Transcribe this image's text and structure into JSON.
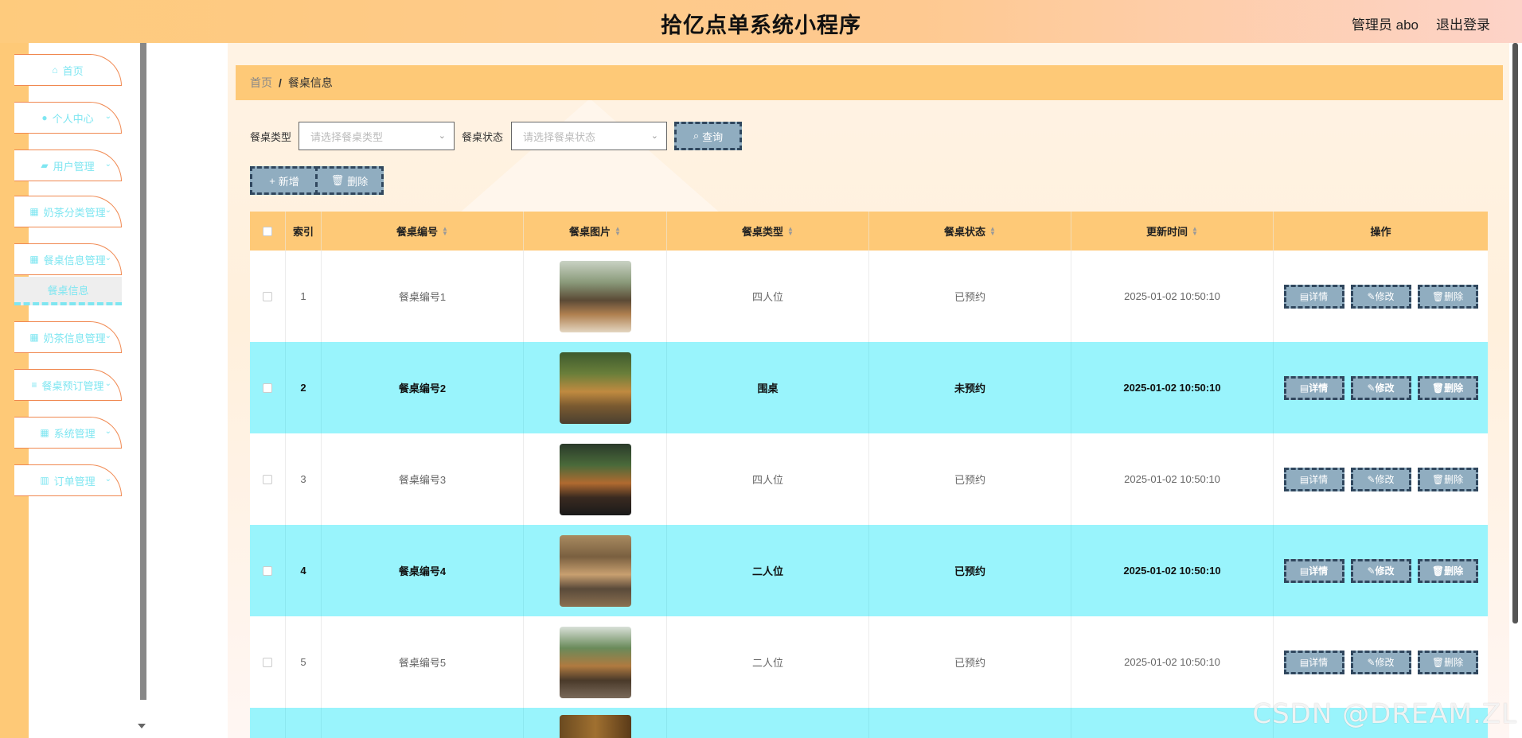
{
  "header": {
    "title": "拾亿点单系统小程序",
    "user": "管理员 abo",
    "logout": "退出登录"
  },
  "sidebar": {
    "items": [
      {
        "label": "首页",
        "icon": "home-icon",
        "has_submenu": false
      },
      {
        "label": "个人中心",
        "icon": "user-icon",
        "has_submenu": true
      },
      {
        "label": "用户管理",
        "icon": "briefcase-icon",
        "has_submenu": true
      },
      {
        "label": "奶茶分类管理",
        "icon": "grid-icon",
        "has_submenu": true
      },
      {
        "label": "餐桌信息管理",
        "icon": "grid-icon",
        "has_submenu": true
      },
      {
        "label": "奶茶信息管理",
        "icon": "grid-icon",
        "has_submenu": true
      },
      {
        "label": "餐桌预订管理",
        "icon": "list-icon",
        "has_submenu": true
      },
      {
        "label": "系统管理",
        "icon": "grid-icon",
        "has_submenu": true
      },
      {
        "label": "订单管理",
        "icon": "trash-icon",
        "has_submenu": true
      }
    ],
    "submenu_active": "餐桌信息"
  },
  "breadcrumb": {
    "home": "首页",
    "separator": "/",
    "current": "餐桌信息"
  },
  "filters": {
    "type_label": "餐桌类型",
    "type_placeholder": "请选择餐桌类型",
    "status_label": "餐桌状态",
    "status_placeholder": "请选择餐桌状态",
    "search_button": "查询"
  },
  "toolbar": {
    "add_button": "新增",
    "delete_button": "删除"
  },
  "table": {
    "headers": [
      "索引",
      "餐桌编号",
      "餐桌图片",
      "餐桌类型",
      "餐桌状态",
      "更新时间",
      "操作"
    ],
    "actions": {
      "detail": "详情",
      "edit": "修改",
      "delete": "删除"
    },
    "rows": [
      {
        "index": "1",
        "number": "餐桌编号1",
        "type": "四人位",
        "status": "已预约",
        "updated": "2025-01-02 10:50:10"
      },
      {
        "index": "2",
        "number": "餐桌编号2",
        "type": "围桌",
        "status": "未预约",
        "updated": "2025-01-02 10:50:10"
      },
      {
        "index": "3",
        "number": "餐桌编号3",
        "type": "四人位",
        "status": "已预约",
        "updated": "2025-01-02 10:50:10"
      },
      {
        "index": "4",
        "number": "餐桌编号4",
        "type": "二人位",
        "status": "已预约",
        "updated": "2025-01-02 10:50:10"
      },
      {
        "index": "5",
        "number": "餐桌编号5",
        "type": "二人位",
        "status": "已预约",
        "updated": "2025-01-02 10:50:10"
      }
    ]
  },
  "watermark": "CSDN @DREAM.ZL",
  "colors": {
    "header_gradient_start": "#fecb7d",
    "header_gradient_end": "#fdd3c8",
    "accent_cyan": "#99f4fc",
    "sidebar_text": "#7fe6f1",
    "menu_border": "#f08850",
    "button_bg": "#90adc0",
    "button_border": "#30475e",
    "table_header": "#fec977"
  }
}
